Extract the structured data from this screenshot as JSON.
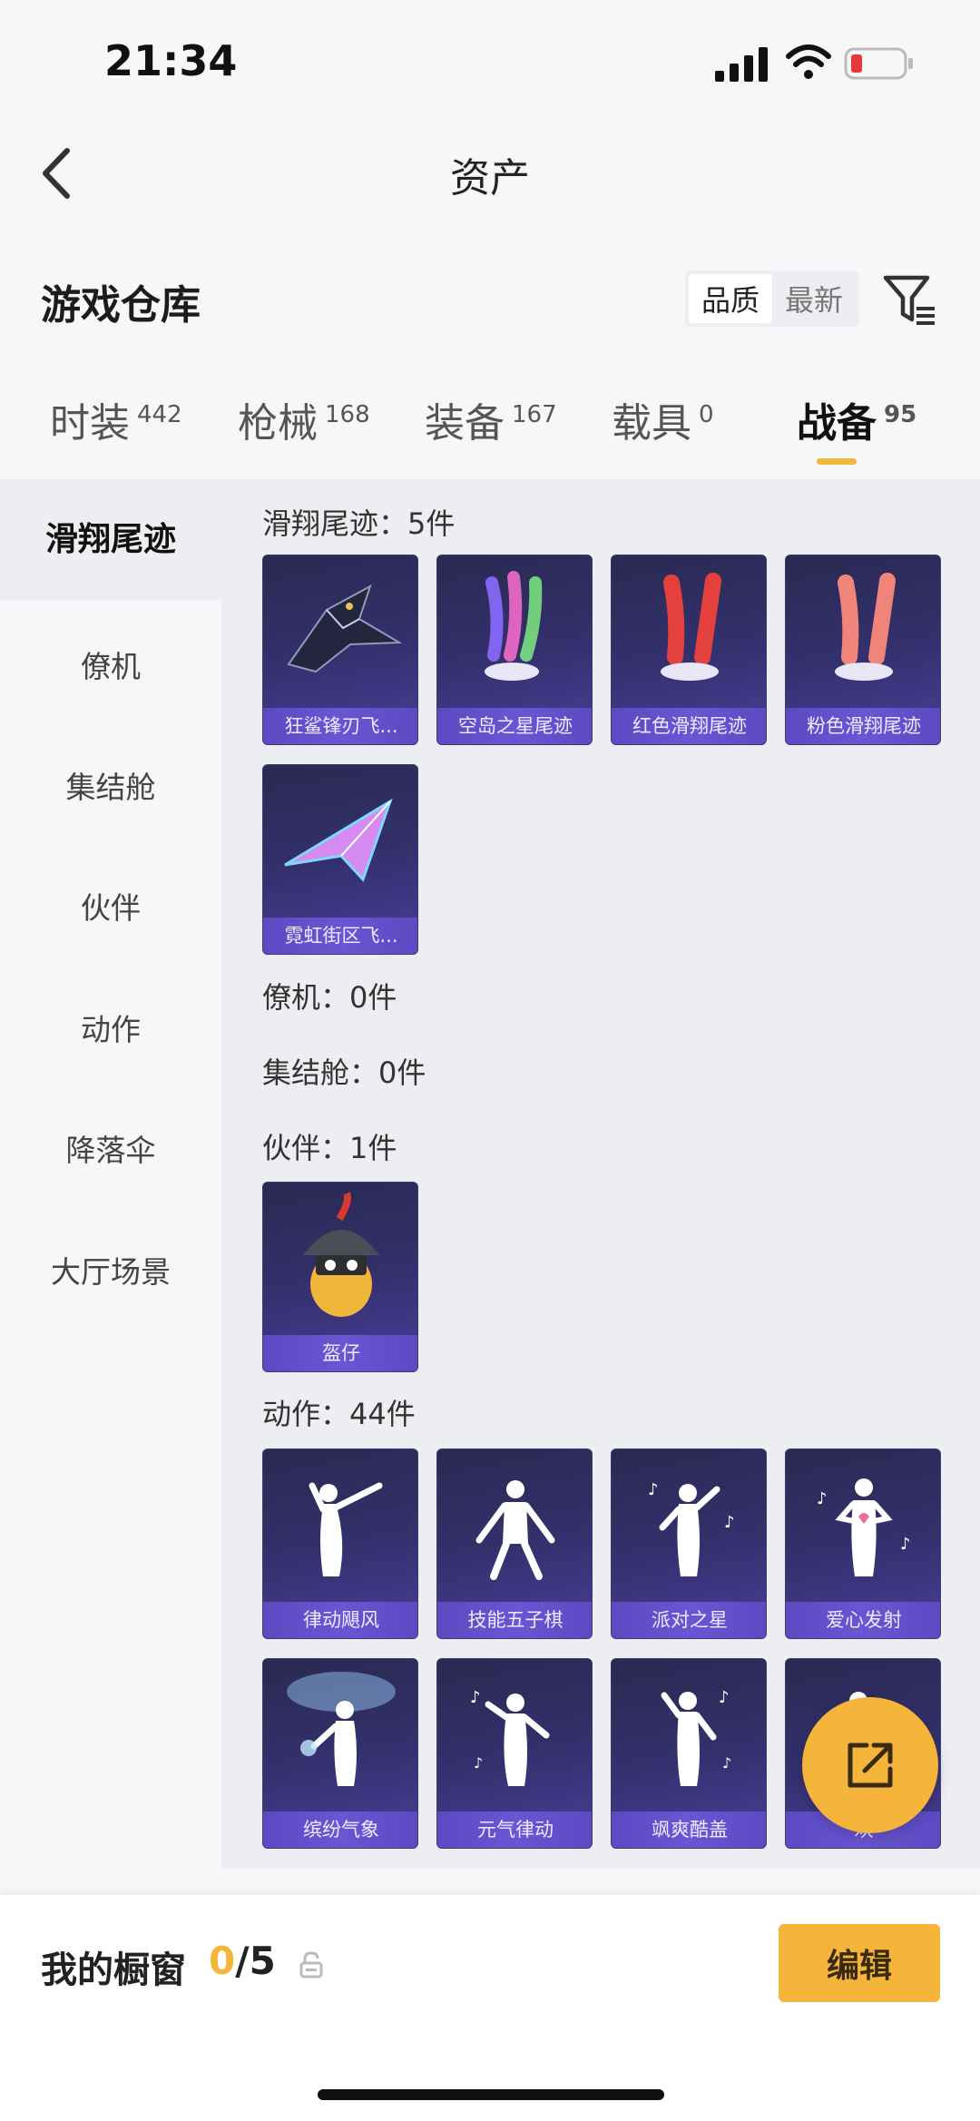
{
  "status": {
    "time": "21:34"
  },
  "nav": {
    "title": "资产"
  },
  "warehouse": {
    "title": "游戏仓库",
    "sort_options": [
      "品质",
      "最新"
    ]
  },
  "tabs": [
    {
      "label": "时装",
      "count": "442"
    },
    {
      "label": "枪械",
      "count": "168"
    },
    {
      "label": "装备",
      "count": "167"
    },
    {
      "label": "载具",
      "count": "0"
    },
    {
      "label": "战备",
      "count": "95"
    }
  ],
  "sidebar": [
    "滑翔尾迹",
    "僚机",
    "集结舱",
    "伙伴",
    "动作",
    "降落伞",
    "大厅场景"
  ],
  "sections": {
    "glide": {
      "title": "滑翔尾迹：5件",
      "items": [
        "狂鲨锋刃飞...",
        "空岛之星尾迹",
        "红色滑翔尾迹",
        "粉色滑翔尾迹",
        "霓虹街区飞..."
      ]
    },
    "wingman": {
      "title": "僚机：0件"
    },
    "pod": {
      "title": "集结舱：0件"
    },
    "partner": {
      "title": "伙伴：1件",
      "items": [
        "盔仔"
      ]
    },
    "emote": {
      "title": "动作：44件",
      "items": [
        "律动飓风",
        "技能五子棋",
        "派对之星",
        "爱心发射",
        "缤纷气象",
        "元气律动",
        "飒爽酷盖",
        "欢"
      ]
    }
  },
  "bottom": {
    "label": "我的橱窗",
    "current": "0",
    "total": "/5",
    "edit": "编辑"
  },
  "colors": {
    "accent": "#f4b53a",
    "card": "#33306c"
  }
}
